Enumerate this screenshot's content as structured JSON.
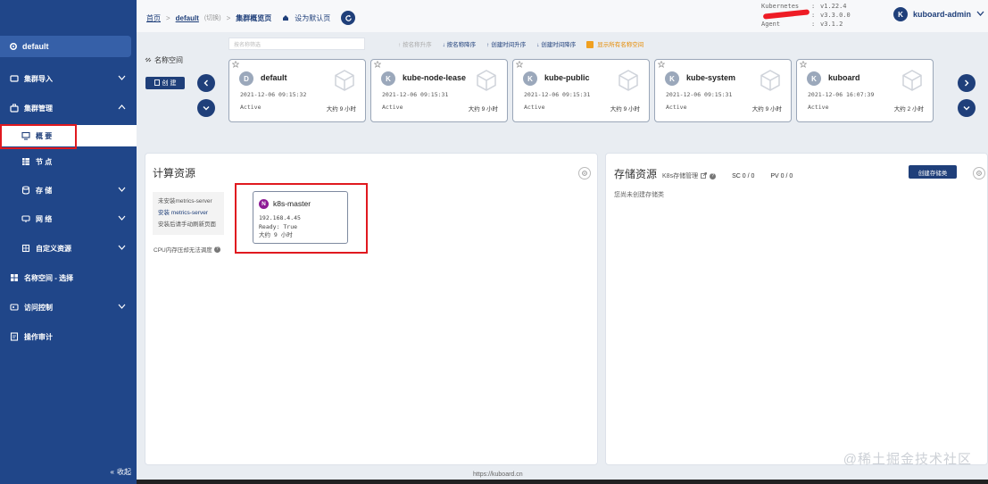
{
  "sidebar": {
    "namespace": "default",
    "items": [
      {
        "label": "集群导入"
      },
      {
        "label": "集群管理"
      },
      {
        "label": "概 要"
      },
      {
        "label": "节 点"
      },
      {
        "label": "存 储"
      },
      {
        "label": "网 络"
      },
      {
        "label": "自定义资源"
      },
      {
        "label": "名称空间 - 选择"
      },
      {
        "label": "访问控制"
      },
      {
        "label": "操作审计"
      }
    ],
    "collapse_label": "收起"
  },
  "topbar": {
    "breadcrumb_home": "首页",
    "breadcrumb_cluster": "default",
    "breadcrumb_cluster_tag": "(切换)",
    "breadcrumb_page": "集群概览页",
    "set_default": "设为默认页",
    "versions": [
      {
        "name": "Kubernetes",
        "value": "v1.22.4"
      },
      {
        "name": "",
        "value": "v3.3.0.0"
      },
      {
        "name": "Agent",
        "value": "v3.1.2"
      }
    ],
    "user": "kuboard-admin",
    "user_initial": "K"
  },
  "namespaces": {
    "label": "名称空间",
    "search_placeholder": "按名称筛选",
    "create_label": "创 建",
    "sort_options": [
      "按名称升序",
      "按名称降序",
      "创建时间升序",
      "创建时间降序"
    ],
    "show_all_label": "显示所有名称空间",
    "cards": [
      {
        "initial": "D",
        "name": "default",
        "created": "2021-12-06 09:15:32",
        "status": "Active",
        "age": "大约 9 小时"
      },
      {
        "initial": "K",
        "name": "kube-node-lease",
        "created": "2021-12-06 09:15:31",
        "status": "Active",
        "age": "大约 9 小时"
      },
      {
        "initial": "K",
        "name": "kube-public",
        "created": "2021-12-06 09:15:31",
        "status": "Active",
        "age": "大约 9 小时"
      },
      {
        "initial": "K",
        "name": "kube-system",
        "created": "2021-12-06 09:15:31",
        "status": "Active",
        "age": "大约 9 小时"
      },
      {
        "initial": "K",
        "name": "kuboard",
        "created": "2021-12-06 16:07:39",
        "status": "Active",
        "age": "大约 2 小时"
      }
    ]
  },
  "compute": {
    "title": "计算资源",
    "metrics_lines": [
      "未安装metrics-server",
      "安装 metrics-server",
      "安装后请手动刷新页面"
    ],
    "cpu_note": "CPU内存压却无法调度",
    "node": {
      "initial": "N",
      "name": "k8s-master",
      "ip": "192.168.4.45",
      "ready": "Ready: True",
      "age": "大约 9 小时"
    }
  },
  "storage": {
    "title": "存储资源",
    "sub_label": "K8s存储管理",
    "sc_label": "SC 0 / 0",
    "pv_label": "PV 0 / 0",
    "create_label": "创建存储类",
    "empty_note": "您尚未创建存储类"
  },
  "footer": {
    "url": "https://kuboard.cn",
    "watermark": "@稀土掘金技术社区"
  },
  "colors": {
    "sidebar_bg": "#204689",
    "primary": "#1f3f7a",
    "highlight_box": "#e0191f",
    "warn": "#f0a020"
  }
}
